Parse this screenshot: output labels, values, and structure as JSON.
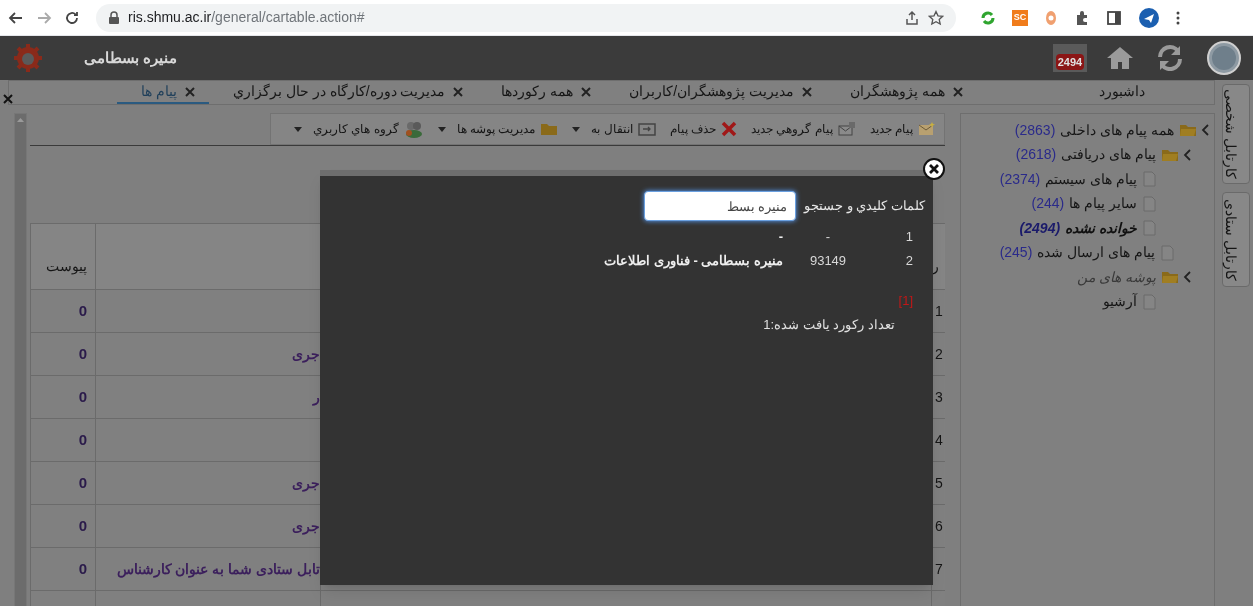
{
  "browser": {
    "url_host": "ris.shmu.ac.ir",
    "url_path": "/general/cartable.action#",
    "extension_badge": "SC"
  },
  "header": {
    "user_name": "منیره بسطامی",
    "mail_badge": "2494"
  },
  "tabs": [
    {
      "label": "داشبورد",
      "closable": false,
      "selected": false
    },
    {
      "label": "همه پژوهشگران",
      "closable": true,
      "selected": false
    },
    {
      "label": "مدیریت پژوهشگران/کاربران",
      "closable": true,
      "selected": false
    },
    {
      "label": "همه رکوردها",
      "closable": true,
      "selected": false
    },
    {
      "label": "مدیریت دوره/کارگاه در حال برگزاري",
      "closable": true,
      "selected": false
    },
    {
      "label": "پیام ها",
      "closable": true,
      "selected": true
    }
  ],
  "side_tabs": [
    {
      "label": "کارتابل شخصی"
    },
    {
      "label": "کارتابل ستادی"
    }
  ],
  "tree": [
    {
      "label": "همه پیام های داخلی",
      "count": "(2863)",
      "kind": "folder",
      "expanded": true,
      "selected": false,
      "children": [
        {
          "label": "پیام های دریافتی",
          "count": "(2618)",
          "kind": "folder",
          "expanded": true,
          "selected": false,
          "children": [
            {
              "label": "پیام های سیستم",
              "count": "(2374)",
              "kind": "file",
              "selected": false
            },
            {
              "label": "سایر پیام ها",
              "count": "(244)",
              "kind": "file",
              "selected": false
            },
            {
              "label": "خوانده نشده",
              "count": "(2494)",
              "kind": "file",
              "selected": true
            }
          ]
        },
        {
          "label": "پیام های ارسال شده",
          "count": "(245)",
          "kind": "file",
          "selected": false
        },
        {
          "label": "پوشه های من",
          "kind": "folder",
          "expanded": true,
          "selected": false,
          "children": [
            {
              "label": "آرشیو",
              "kind": "file",
              "selected": false
            }
          ]
        }
      ]
    }
  ],
  "toolbar": [
    {
      "label": "پیام جدید",
      "kind": "new",
      "dropdown": false
    },
    {
      "label": "پیام گروهي جدید",
      "kind": "group",
      "dropdown": false
    },
    {
      "label": "حذف پیام",
      "kind": "delete",
      "dropdown": false
    },
    {
      "label": "انتقال به",
      "kind": "move",
      "dropdown": true
    },
    {
      "label": "مدیریت پوشه ها",
      "kind": "folder",
      "dropdown": true
    },
    {
      "label": "گروه هاي کاربري",
      "kind": "users",
      "dropdown": true
    }
  ],
  "table": {
    "columns": [
      {
        "label": "ر"
      },
      {
        "label": "پیوست"
      }
    ],
    "rows": [
      {
        "number": "1",
        "attachments": "0"
      },
      {
        "number": "2",
        "attachments": "0",
        "subject": "جری"
      },
      {
        "number": "3",
        "attachments": "0",
        "subject": "ر"
      },
      {
        "number": "4",
        "attachments": "0"
      },
      {
        "number": "5",
        "attachments": "0",
        "subject": "جری"
      },
      {
        "number": "6",
        "attachments": "0",
        "subject": "جری"
      },
      {
        "number": "7",
        "attachments": "0",
        "subject": "تابل ستادی شما به عنوان کارشناس"
      }
    ]
  },
  "dialog": {
    "search_label": "کلمات کليدي و جستجو",
    "search_value": "منیره بسط",
    "results": [
      {
        "cells": [
          "1",
          "-",
          "-"
        ]
      },
      {
        "cells": [
          "2",
          "93149",
          "منیره بسطامی - فناوری اطلاعات"
        ]
      }
    ],
    "page_marker": "[1]",
    "record_count": "تعداد رکورد يافت شده:1"
  }
}
